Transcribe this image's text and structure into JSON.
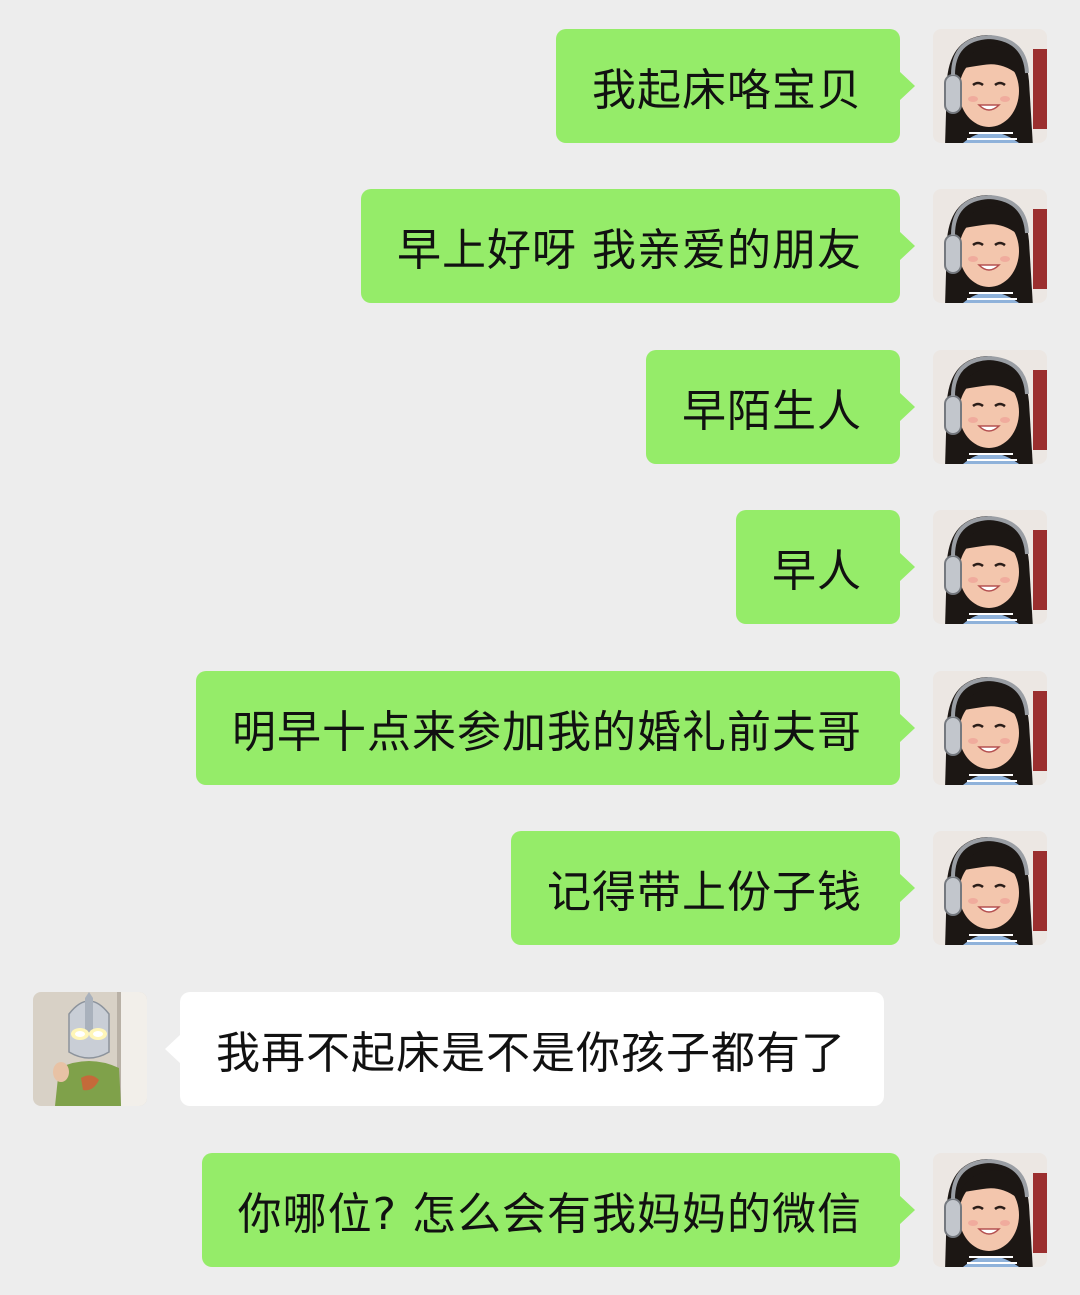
{
  "colors": {
    "background": "#ededed",
    "self_bubble": "#95ec69",
    "other_bubble": "#ffffff",
    "text": "#111111"
  },
  "messages": [
    {
      "sender": "self",
      "avatar": "girl-with-headphones-avatar",
      "text": "我起床咯宝贝"
    },
    {
      "sender": "self",
      "avatar": "girl-with-headphones-avatar",
      "text": "早上好呀 我亲爱的朋友"
    },
    {
      "sender": "self",
      "avatar": "girl-with-headphones-avatar",
      "text": "早陌生人"
    },
    {
      "sender": "self",
      "avatar": "girl-with-headphones-avatar",
      "text": "早人"
    },
    {
      "sender": "self",
      "avatar": "girl-with-headphones-avatar",
      "text": "明早十点来参加我的婚礼前夫哥"
    },
    {
      "sender": "self",
      "avatar": "girl-with-headphones-avatar",
      "text": "记得带上份子钱"
    },
    {
      "sender": "other",
      "avatar": "ultraman-mask-avatar",
      "text": "我再不起床是不是你孩子都有了"
    },
    {
      "sender": "self",
      "avatar": "girl-with-headphones-avatar",
      "text": "你哪位? 怎么会有我妈妈的微信"
    }
  ]
}
